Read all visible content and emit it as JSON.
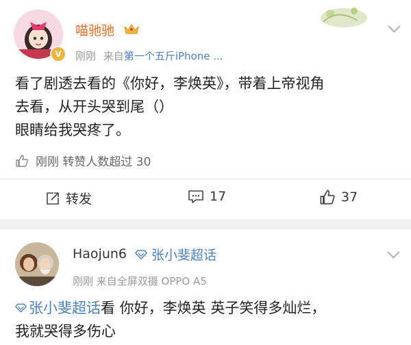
{
  "post1": {
    "username": "喵驰驰",
    "time": "刚刚",
    "from_label": "来自",
    "source": "第一个五斤iPhone ...",
    "text_line1": "看了剧透去看的《你好，李焕英》，带着上帝视角",
    "text_line2": "去看，从开头哭到尾（）",
    "text_line3": "眼睛给我哭疼了。",
    "like_summary": "刚刚 转赞人数超过 30",
    "actions": {
      "repost": "转发",
      "comments": "17",
      "likes": "37"
    }
  },
  "post2": {
    "username": "Haojun6",
    "topic": "张小斐超话",
    "meta": "刚刚 来自全屏双摄 OPPO A5",
    "text_topic": "张小斐超话",
    "text_line1_rest": "看 你好，李焕英 英子笑得多灿烂，",
    "text_line2": "我就哭得多伤心"
  },
  "colors": {
    "link": "#4a7fc1",
    "username_vip": "#f26b21"
  }
}
